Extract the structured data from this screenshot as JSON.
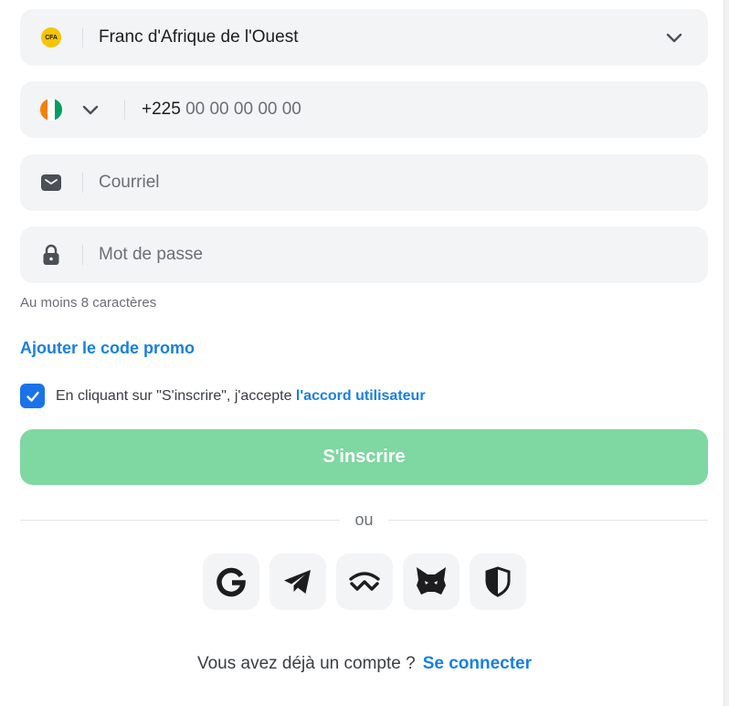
{
  "currency": {
    "badge": "CFA",
    "value": "Franc d'Afrique de l'Ouest",
    "icon": "chevron-down-icon"
  },
  "phone": {
    "country_flag": "cote-divoire-flag-icon",
    "flag_colors": [
      "#f77f00",
      "#ffffff",
      "#009e60"
    ],
    "code": "+225",
    "placeholder": " 00 00 00 00 00"
  },
  "email": {
    "icon": "envelope-icon",
    "placeholder": "Courriel"
  },
  "password": {
    "icon": "lock-icon",
    "placeholder": "Mot de passe",
    "hint": "Au moins 8 caractères"
  },
  "promo": {
    "label": "Ajouter le code promo"
  },
  "agreement": {
    "checked": true,
    "text": "En cliquant sur \"S'inscrire\", j'accepte ",
    "link": "l'accord utilisateur"
  },
  "submit": {
    "label": "S'inscrire",
    "color": "#7fd7a1"
  },
  "divider": {
    "label": "ou"
  },
  "social_logins": [
    "google-icon",
    "telegram-icon",
    "walletconnect-icon",
    "metamask-icon",
    "shield-icon"
  ],
  "login": {
    "text": "Vous avez déjà un compte ?",
    "link": "Se connecter"
  },
  "colors": {
    "accent": "#1a7fe0",
    "field_bg": "#f3f4f6"
  }
}
